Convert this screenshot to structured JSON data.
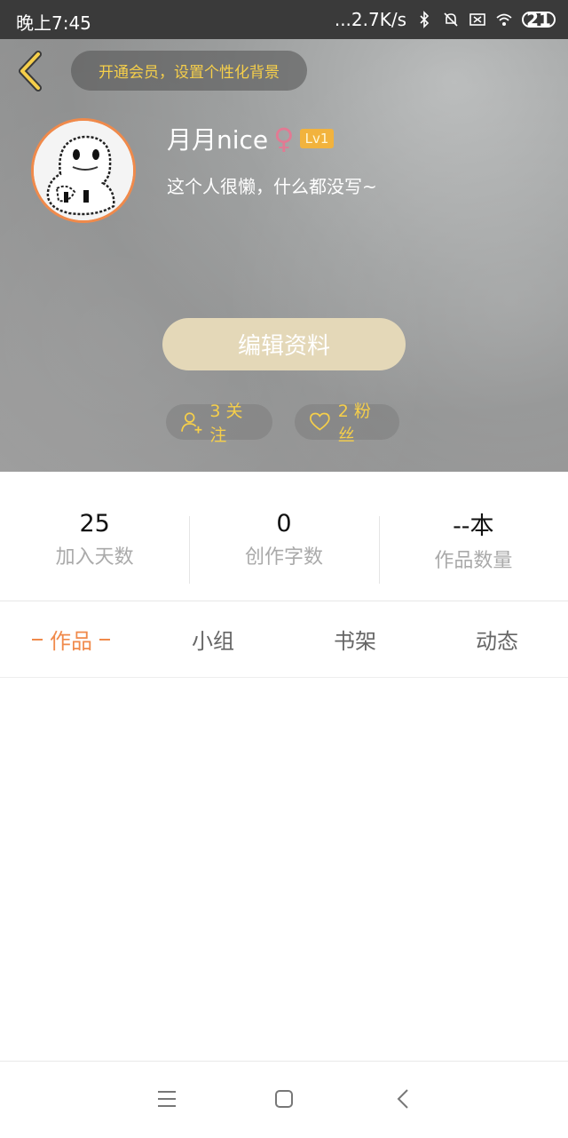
{
  "status_bar": {
    "time": "晚上7:45",
    "network_speed": "...2.7K/s",
    "battery_level": "21",
    "icons": [
      "bluetooth-icon",
      "mute-icon",
      "sim-icon",
      "wifi-icon",
      "battery-icon"
    ]
  },
  "header": {
    "vip_prompt": "开通会员，设置个性化背景",
    "username": "月月nice",
    "gender_symbol": "♀",
    "level": "Lv1",
    "bio": "这个人很懒，什么都没写~",
    "edit_profile_label": "编辑资料",
    "following_label": "3 关注",
    "followers_label": "2 粉丝"
  },
  "stats": [
    {
      "value": "25",
      "label": "加入天数"
    },
    {
      "value": "0",
      "label": "创作字数"
    },
    {
      "value": "--本",
      "label": "作品数量"
    }
  ],
  "tabs": [
    {
      "label": "作品",
      "active": true
    },
    {
      "label": "小组",
      "active": false
    },
    {
      "label": "书架",
      "active": false
    },
    {
      "label": "动态",
      "active": false
    }
  ],
  "colors": {
    "accent": "#f08a4b",
    "gold": "#f6cf4a",
    "edit_button": "#e4d8b8",
    "level_badge": "#f2b33d"
  }
}
